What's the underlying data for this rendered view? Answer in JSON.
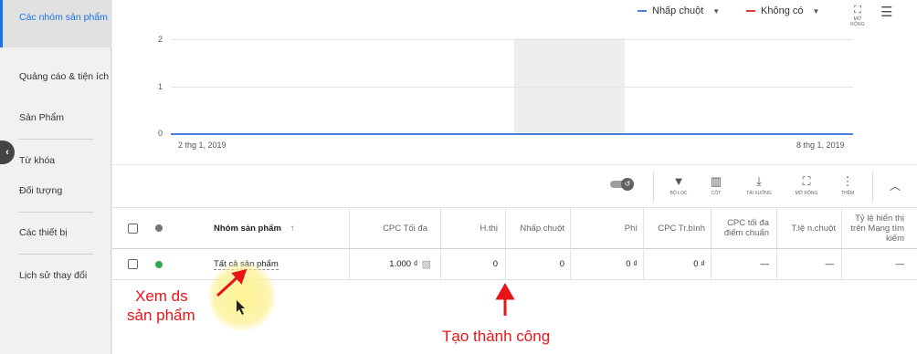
{
  "sidebar": {
    "items": [
      {
        "label": "Các nhóm sản phẩm",
        "active": true
      },
      {
        "label": "Quảng cáo & tiện ích"
      },
      {
        "label": "Sản Phẩm"
      },
      {
        "label": "Từ khóa"
      },
      {
        "label": "Đối tượng"
      },
      {
        "label": "Các thiết bị"
      },
      {
        "label": "Lịch sử thay đổi"
      }
    ]
  },
  "chart": {
    "metric1": "Nhấp chuột",
    "metric1_color": "#4a7fe0",
    "metric2": "Không có",
    "metric2_color": "#e53935",
    "expand_label": "MỞ RỘNG",
    "y_ticks": [
      "2",
      "1",
      "0"
    ],
    "x_start": "2 thg 1, 2019",
    "x_end": "8 thg 1, 2019"
  },
  "chart_data": {
    "type": "line",
    "x": [
      "2 thg 1, 2019",
      "8 thg 1, 2019"
    ],
    "series": [
      {
        "name": "Nhấp chuột",
        "values": [
          0,
          0
        ]
      }
    ],
    "ylim": [
      0,
      2
    ]
  },
  "toolbar": {
    "filter": "BỘ LỌC",
    "columns": "CỘT",
    "download": "TẢI XUỐNG",
    "expand": "MỞ RỘNG",
    "more": "THÊM"
  },
  "table": {
    "headers": {
      "name": "Nhóm sản phẩm",
      "max_cpc": "CPC Tối đa",
      "impr": "H.thị",
      "clicks": "Nhấp chuột",
      "cost": "Phí",
      "avg_cpc": "CPC Tr.bình",
      "bench_cpc": "CPC tối đa điểm chuẩn",
      "ctr": "T.lệ n.chuột",
      "search_is": "Tỷ lệ hiển thị trên Mạng tìm kiếm"
    },
    "rows": [
      {
        "name": "Tất cả sản phẩm",
        "status_color": "#34a853",
        "max_cpc": "1.000 ₫",
        "impr": "0",
        "clicks": "0",
        "cost": "0 ₫",
        "avg_cpc": "0 ₫",
        "bench_cpc": "—",
        "ctr": "—",
        "search_is": "—"
      }
    ]
  },
  "annotations": {
    "view_products": [
      "Xem ds",
      "sản phẩm"
    ],
    "created": "Tạo thành công",
    "color": "#e8141a"
  }
}
